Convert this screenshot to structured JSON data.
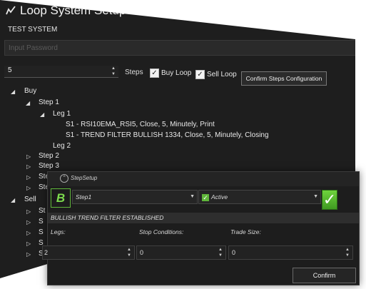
{
  "window": {
    "title": "Loop System Setup",
    "system_name": "TEST SYSTEM",
    "password": {
      "placeholder": "Input Password",
      "value": ""
    },
    "steps": {
      "value": "5",
      "label": "Steps"
    },
    "buy_loop": {
      "label": "Buy Loop",
      "checked": true
    },
    "sell_loop": {
      "label": "Sell Loop",
      "checked": true
    },
    "confirm_steps_label": "Confirm Steps Configuration"
  },
  "tree": {
    "buy": "Buy",
    "step1": "Step 1",
    "leg1": "Leg 1",
    "rule1": "S1 - RSI10EMA_RSI5, Close, 5,  Minutely, Print",
    "rule2": "S1 - TREND FILTER BULLISH 1334, Close, 5,  Minutely, Closing",
    "leg2": "Leg 2",
    "step2": "Step 2",
    "step3": "Step 3",
    "step4": "Ste",
    "step5": "Ste",
    "sell": "Sell",
    "sell_s1": "St",
    "sell_s2": "S",
    "sell_s3": "S",
    "sell_s4": "S",
    "sell_s5": "S"
  },
  "dialog": {
    "title": "StepSetup",
    "badge": "B",
    "step_select": "Step1",
    "active_select": "Active",
    "status": "BULLISH TREND FILTER ESTABLISHED",
    "legs_label": "Legs:",
    "stop_label": "Stop Conditions:",
    "trade_label": "Trade Size:",
    "legs_value": "2",
    "stop_value": "0",
    "trade_value": "0",
    "confirm_label": "Confirm"
  },
  "colors": {
    "accent_green": "#5fb63a",
    "background": "#1e1e1e"
  }
}
